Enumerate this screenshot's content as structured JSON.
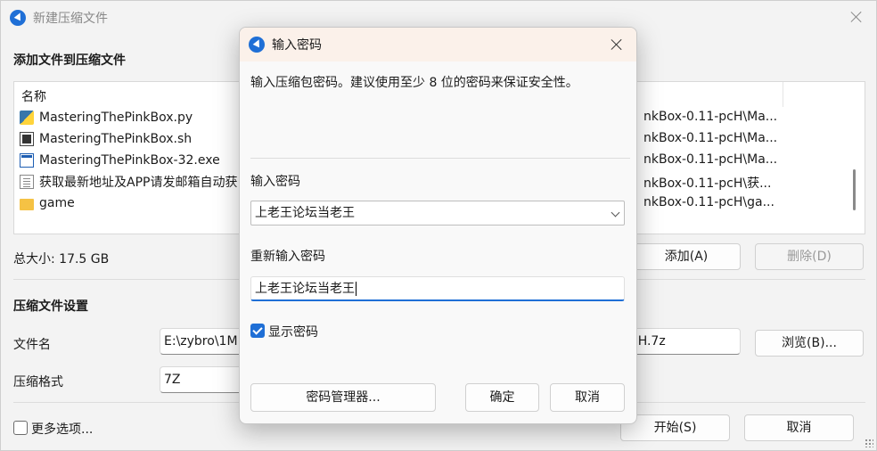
{
  "main": {
    "title": "新建压缩文件",
    "section_add": "添加文件到压缩文件",
    "list_header": "名称",
    "files": [
      {
        "name": "MasteringThePinkBox.py",
        "icon": "python-file-icon",
        "path": "nkBox-0.11-pcH\\Ma..."
      },
      {
        "name": "MasteringThePinkBox.sh",
        "icon": "shell-file-icon",
        "path": "nkBox-0.11-pcH\\Ma..."
      },
      {
        "name": "MasteringThePinkBox-32.exe",
        "icon": "exe-file-icon",
        "path": "nkBox-0.11-pcH\\Ma..."
      },
      {
        "name": "获取最新地址及APP请发邮箱自动获",
        "icon": "text-file-icon",
        "path": "nkBox-0.11-pcH\\获..."
      },
      {
        "name": "game",
        "icon": "folder-icon",
        "path": "nkBox-0.11-pcH\\ga..."
      }
    ],
    "total_size": "总大小: 17.5 GB",
    "add_button": "添加(A)",
    "remove_button": "删除(D)",
    "section_settings": "压缩文件设置",
    "filename_label": "文件名",
    "filename_value": "E:\\zybro\\1M",
    "filename_tail": "cH.7z",
    "browse_button": "浏览(B)...",
    "format_label": "压缩格式",
    "format_value": "7Z",
    "more_options": "更多选项...",
    "start_button": "开始(S)",
    "cancel_button": "取消"
  },
  "dialog": {
    "title": "输入密码",
    "description": "输入压缩包密码。建议使用至少 8 位的密码来保证安全性。",
    "password_label": "输入密码",
    "password_value": "上老王论坛当老王",
    "reenter_label": "重新输入密码",
    "reenter_value": "上老王论坛当老王",
    "show_password_label": "显示密码",
    "show_password_checked": true,
    "manager_button": "密码管理器...",
    "ok_button": "确定",
    "cancel_button": "取消"
  },
  "colors": {
    "accent": "#1f6fd6",
    "dialog_title_bg": "#fbf1ea",
    "window_bg": "#f3f3f3"
  }
}
